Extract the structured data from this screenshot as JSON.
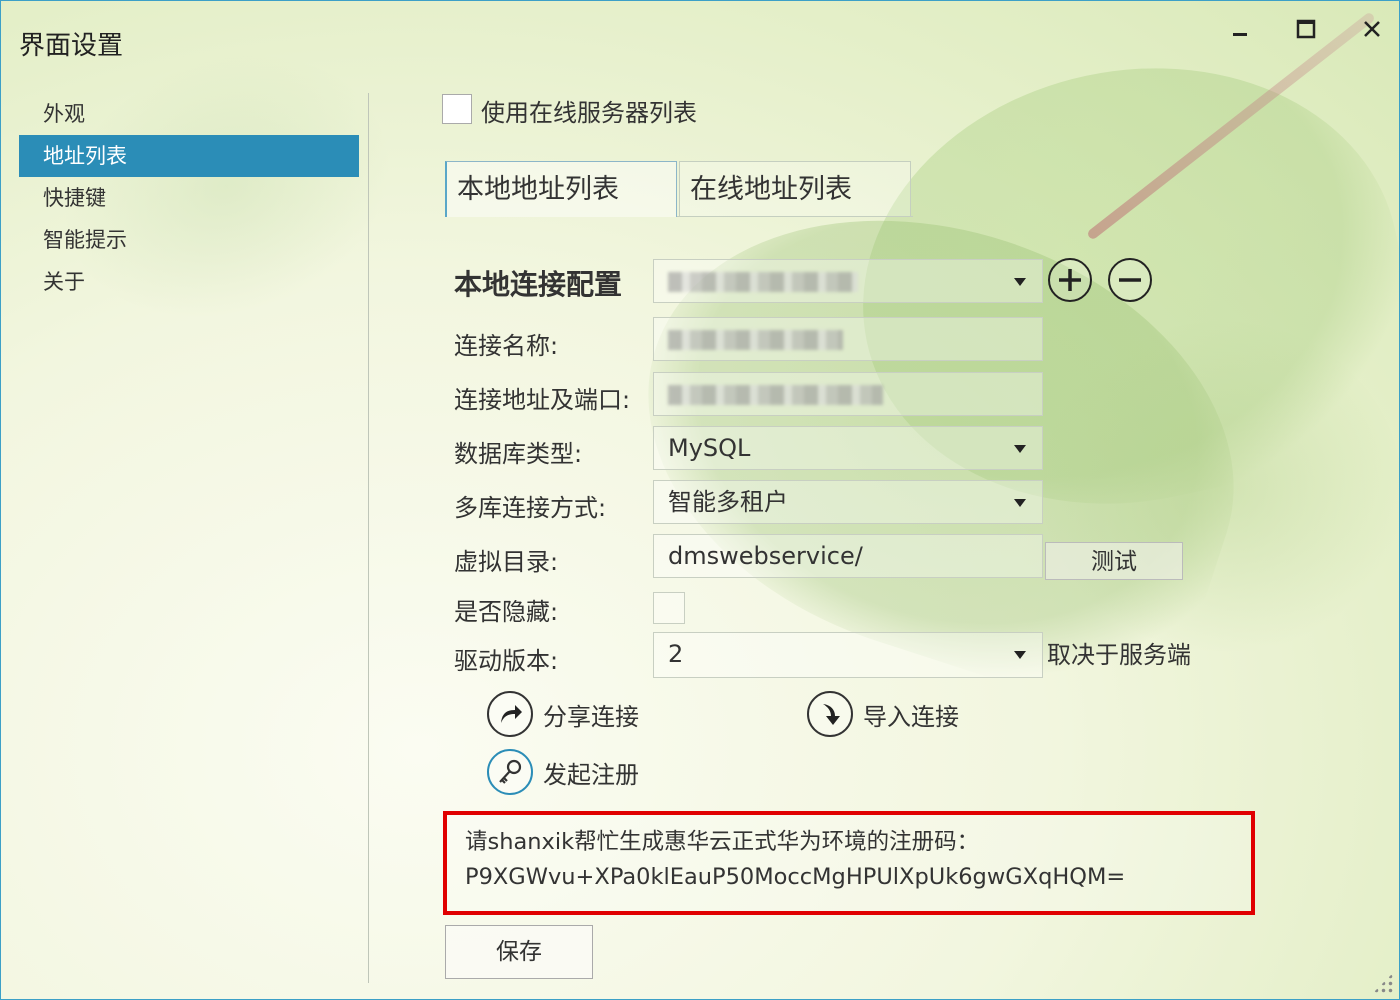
{
  "window": {
    "title": "界面设置",
    "controls": {
      "minimize": "–",
      "maximize": "☐",
      "close": "✕"
    }
  },
  "sidebar": {
    "items": [
      {
        "label": "外观",
        "active": false
      },
      {
        "label": "地址列表",
        "active": true
      },
      {
        "label": "快捷键",
        "active": false
      },
      {
        "label": "智能提示",
        "active": false
      },
      {
        "label": "关于",
        "active": false
      }
    ]
  },
  "online_server": {
    "label": "使用在线服务器列表",
    "checked": false
  },
  "tabs": [
    {
      "label": "本地地址列表",
      "selected": true
    },
    {
      "label": "在线地址列表",
      "selected": false
    }
  ],
  "form": {
    "section_title": "本地连接配置",
    "config_select": {
      "value": "",
      "redacted": true
    },
    "name": {
      "label": "连接名称:",
      "value": "",
      "redacted": true
    },
    "address": {
      "label": "连接地址及端口:",
      "value": "",
      "redacted": true
    },
    "db_type": {
      "label": "数据库类型:",
      "value": "MySQL"
    },
    "multi_db": {
      "label": "多库连接方式:",
      "value": "智能多租户"
    },
    "virtual_dir": {
      "label": "虚拟目录:",
      "value": "dmswebservice/"
    },
    "test_button": "测试",
    "hidden": {
      "label": "是否隐藏:",
      "checked": false
    },
    "driver": {
      "label": "驱动版本:",
      "value": "2",
      "note": "取决于服务端"
    }
  },
  "actions": {
    "share": "分享连接",
    "import": "导入连接",
    "register": "发起注册"
  },
  "registration": {
    "line1": "请shanxik帮忙生成惠华云正式华为环境的注册码：",
    "line2": "P9XGWvu+XPa0klEauP50MoccMgHPUlXpUk6gwGXqHQM="
  },
  "save_button": "保存",
  "colors": {
    "accent": "#2b8db7",
    "highlight_border": "#e00000",
    "text": "#333333"
  }
}
